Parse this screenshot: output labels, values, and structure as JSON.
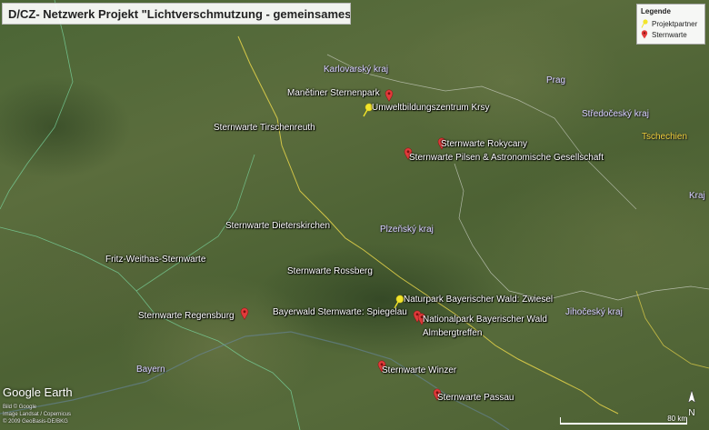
{
  "title": "D/CZ- Netzwerk Projekt \"Lichtverschmutzung - gemeinsames Verfahren",
  "legend": {
    "heading": "Legende",
    "items": [
      {
        "label": "Projektpartner",
        "icon": "yellow-pushpin-icon",
        "color": "#f2e52a"
      },
      {
        "label": "Sternwarte",
        "icon": "red-marker-icon",
        "color": "#e23b3b"
      }
    ]
  },
  "places": {
    "manetiner": "Manětiner Sternenpark",
    "umwelt": "Umweltbildungszentrum Krsy",
    "tirschenreuth": "Sternwarte Tirschenreuth",
    "rokycany": "Sternwarte Rokycany",
    "pilsen": "Sternwarte Pilsen & Astronomische Gesellschaft",
    "dieterskirchen": "Sternwarte Dieterskirchen",
    "fritz": "Fritz-Weithas-Sternwarte",
    "rossberg": "Sternwarte Rossberg",
    "naturpark": "Naturpark Bayerischer Wald: Zwiesel",
    "regensburg": "Sternwarte Regensburg",
    "spiegelau": "Bayerwald Sternwarte: Spiegelau",
    "nationalpark": "Nationalpark Bayerischer Wald",
    "almberg": "Almbergtreffen",
    "winzer": "Sternwarte Winzer",
    "passau": "Sternwarte Passau"
  },
  "regions": {
    "karlovarsky": "Karlovarský kraj",
    "prag": "Prag",
    "stredocesky": "Středočeský kraj",
    "plzensky": "Plzeňský kraj",
    "jihocesky": "Jihočeský kraj",
    "kraj": "Kraj",
    "bayern": "Bayern",
    "tschechien": "Tschechien"
  },
  "footer": {
    "logo": "Google Earth",
    "credit1": "Bild © Google",
    "credit2": "Image Landsat / Copernicus",
    "credit3": "© 2009 GeoBasis-DE/BKG",
    "scale_label": "80 km",
    "north_label": "N"
  }
}
